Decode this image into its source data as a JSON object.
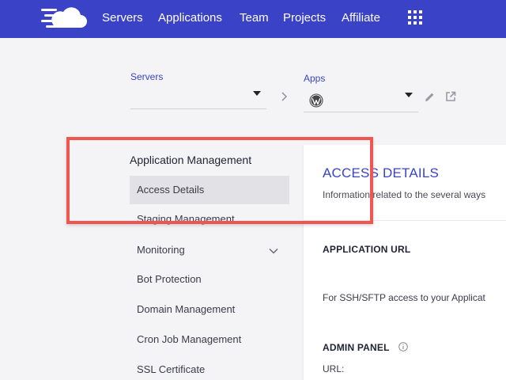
{
  "nav": {
    "logo_icon": "cloudways-cloud-logo",
    "links": [
      "Servers",
      "Applications",
      "Team",
      "Projects",
      "Affiliate"
    ],
    "grid_icon": "apps-grid-icon",
    "brand_color": "#3a43c8"
  },
  "selectors": {
    "servers_label": "Servers",
    "apps_label": "Apps",
    "apps_icon": "wordpress-icon"
  },
  "menu": {
    "title": "Application Management",
    "items": [
      "Access Details",
      "Staging Management",
      "Monitoring",
      "Bot Protection",
      "Domain Management",
      "Cron Job Management",
      "SSL Certificate"
    ],
    "active_index": 0
  },
  "content": {
    "title": "ACCESS DETAILS",
    "subtitle": "Information related to the several ways",
    "application_url_heading": "APPLICATION URL",
    "ssh_text": "For SSH/SFTP access to your Applicat",
    "admin_panel_heading": "ADMIN PANEL",
    "url_label": "URL:"
  },
  "annotation": {
    "highlight_color": "#f0564f"
  }
}
